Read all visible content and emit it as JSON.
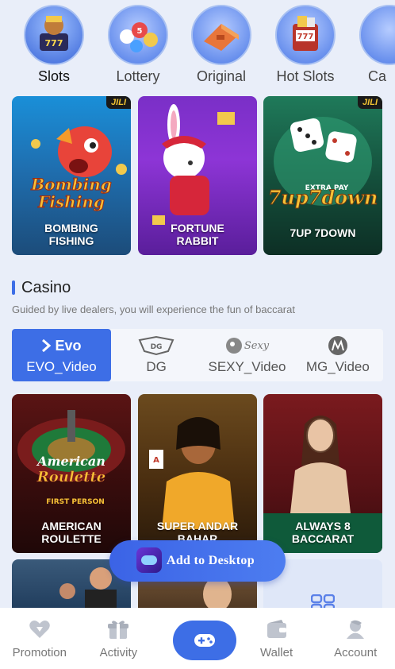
{
  "categories": [
    {
      "label": "Slots",
      "active": true
    },
    {
      "label": "Lottery"
    },
    {
      "label": "Original"
    },
    {
      "label": "Hot Slots"
    },
    {
      "label": "Ca"
    }
  ],
  "games_top": [
    {
      "title": "BOMBING FISHING",
      "art_title_1": "Bombing",
      "art_title_2": "Fishing",
      "badge": "JILI"
    },
    {
      "title": "FORTUNE RABBIT"
    },
    {
      "title": "7UP 7DOWN",
      "art_title": "7up7down",
      "extra": "EXTRA PAY",
      "badge": "JILI"
    }
  ],
  "casino": {
    "title": "Casino",
    "subtitle": "Guided by live dealers, you will experience the fun of baccarat",
    "tabs": [
      {
        "label": "EVO_Video",
        "logo": "Evo",
        "active": true
      },
      {
        "label": "DG"
      },
      {
        "label": "SEXY_Video",
        "logo": "Sexy"
      },
      {
        "label": "MG_Video"
      }
    ]
  },
  "games_casino": [
    {
      "title": "AMERICAN ROULETTE",
      "art_title_1": "American",
      "art_title_2": "Roulette",
      "art_sub": "FIRST PERSON"
    },
    {
      "title": "SUPER ANDAR BAHAR"
    },
    {
      "title": "ALWAYS 8 BACCARAT"
    }
  ],
  "add_desktop": {
    "label": "Add to Desktop"
  },
  "nav": [
    {
      "label": "Promotion"
    },
    {
      "label": "Activity"
    },
    {
      "label": "Wallet"
    },
    {
      "label": "Account"
    }
  ],
  "colors": {
    "accent": "#3d6ee6",
    "bg": "#e9eef9"
  }
}
